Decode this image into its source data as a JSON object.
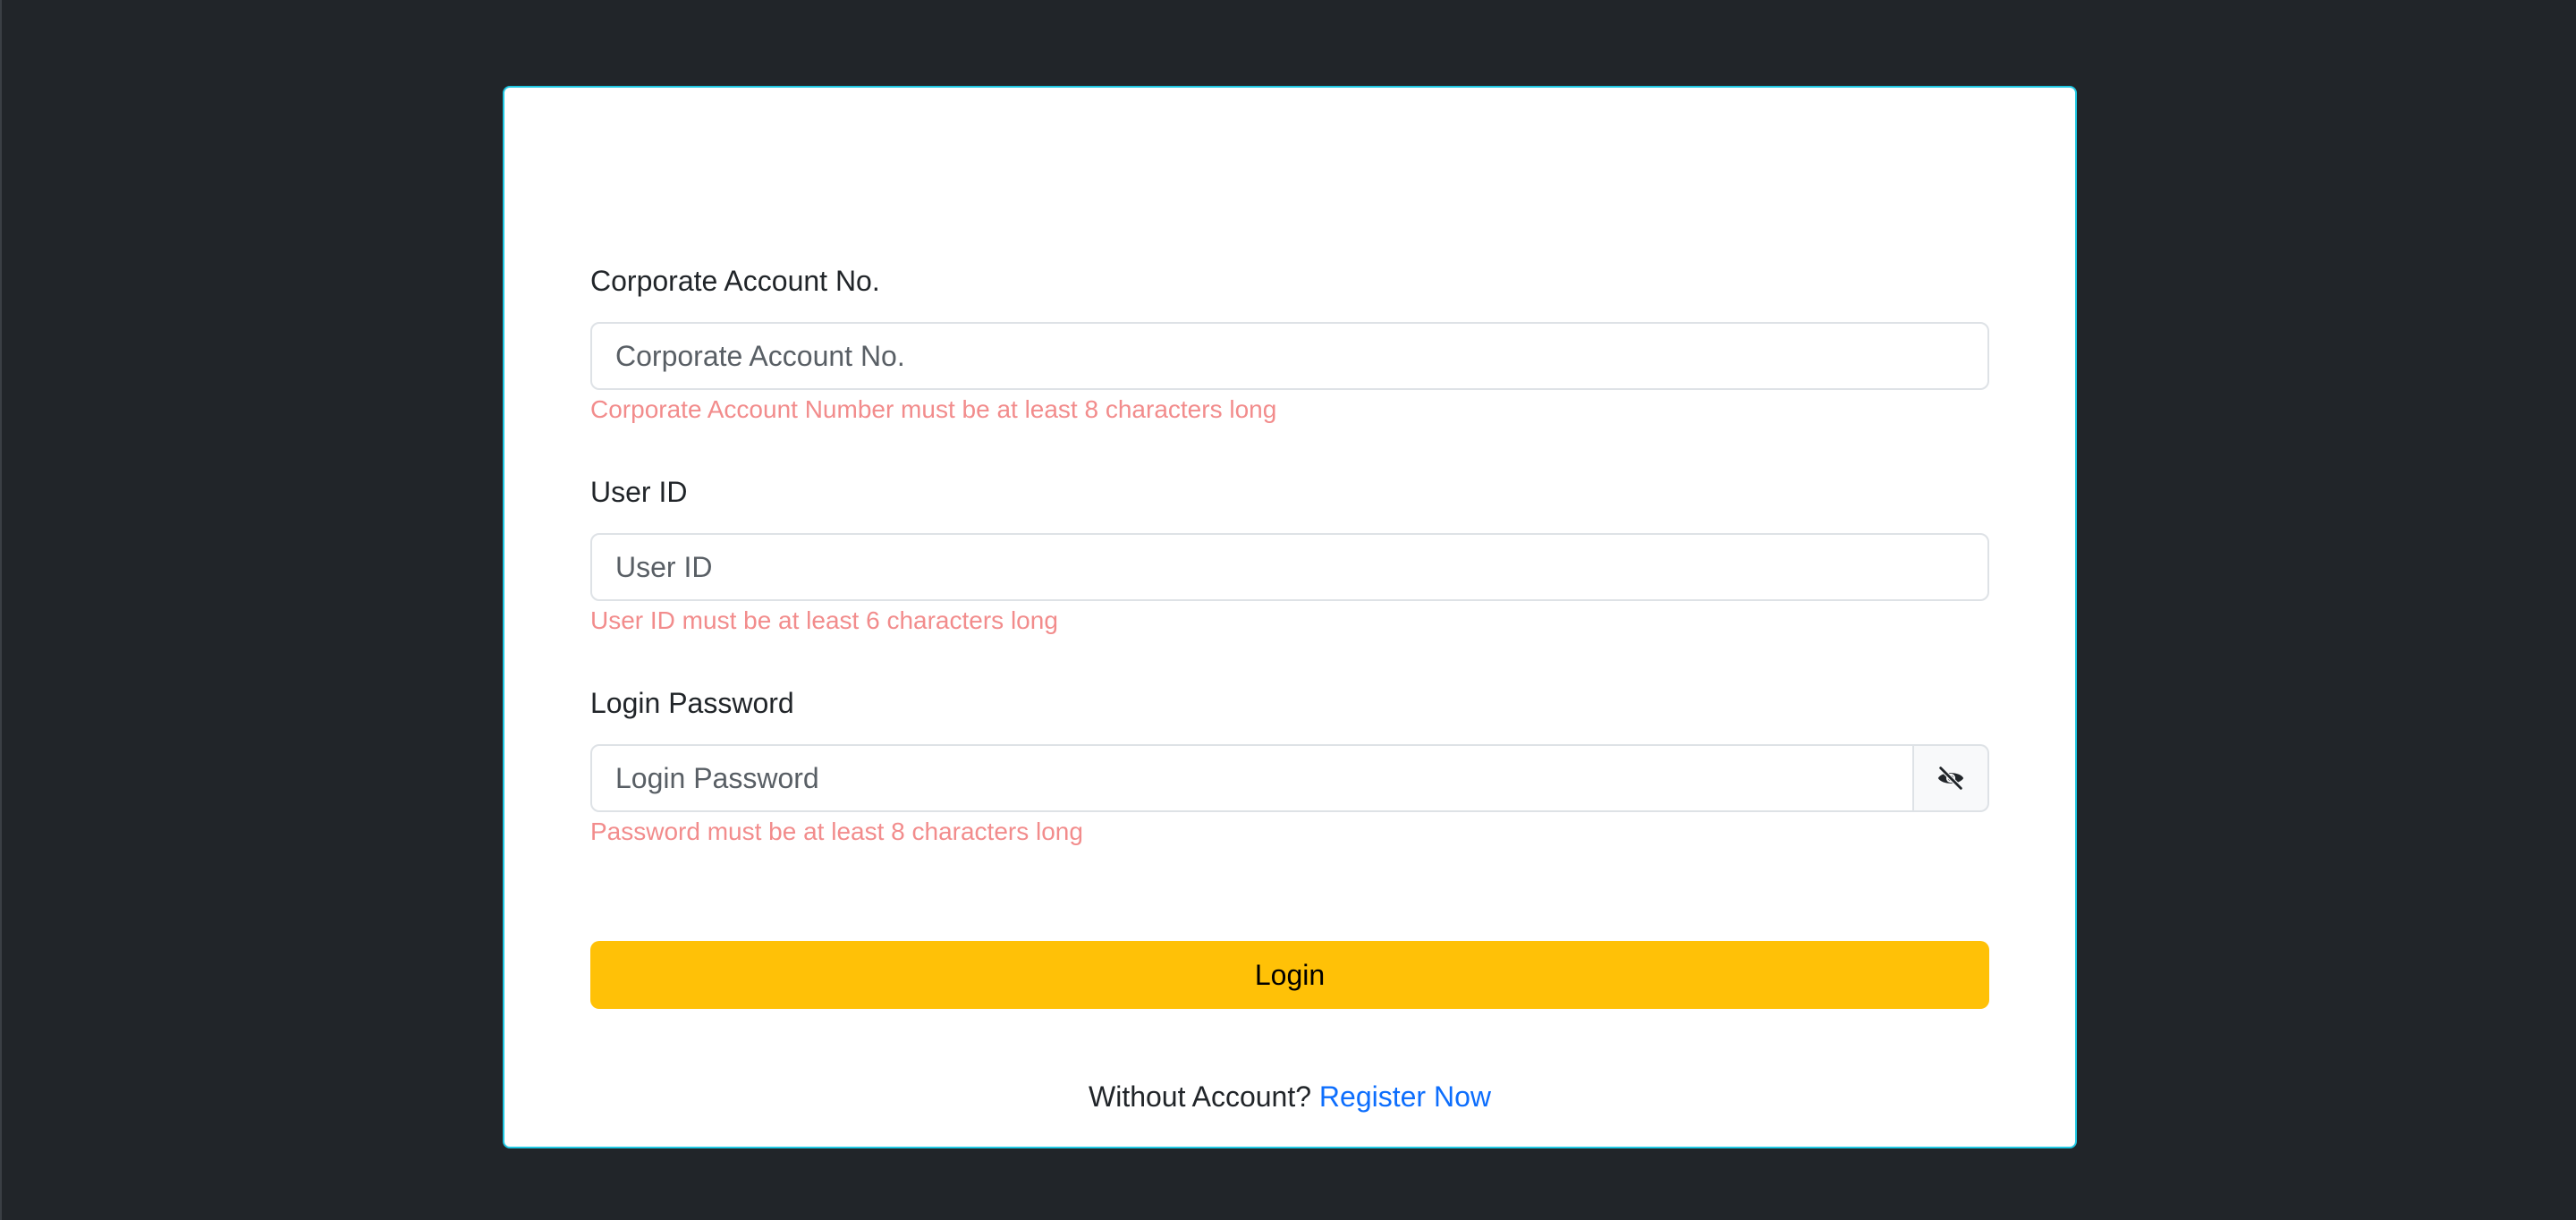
{
  "form": {
    "corporate_account": {
      "label": "Corporate Account No.",
      "placeholder": "Corporate Account No.",
      "value": "",
      "error": "Corporate Account Number must be at least 8 characters long"
    },
    "user_id": {
      "label": "User ID",
      "placeholder": "User ID",
      "value": "",
      "error": "User ID must be at least 6 characters long"
    },
    "password": {
      "label": "Login Password",
      "placeholder": "Login Password",
      "value": "",
      "error": "Password must be at least 8 characters long",
      "toggle_icon": "eye-slash-icon"
    },
    "login_button": "Login"
  },
  "register": {
    "prompt": "Without Account?",
    "link_text": "Register Now"
  },
  "colors": {
    "background": "#212529",
    "card_border": "#1fc8e3",
    "error": "#f28c8c",
    "primary_button": "#ffc107",
    "link": "#0d6efd"
  }
}
